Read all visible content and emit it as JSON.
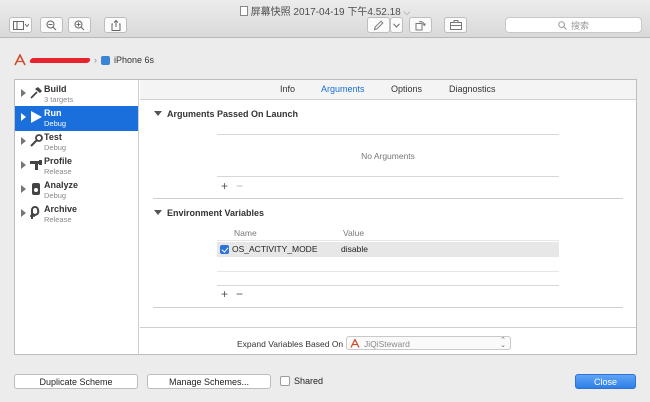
{
  "window": {
    "title": "屏幕快照 2017-04-19 下午4.52.18",
    "search_placeholder": "搜索"
  },
  "scheme": {
    "device": "iPhone 6s"
  },
  "sidebar": {
    "items": [
      {
        "name": "Build",
        "sub": "3 targets",
        "icon": "hammer-icon"
      },
      {
        "name": "Run",
        "sub": "Debug",
        "icon": "play-icon",
        "selected": true
      },
      {
        "name": "Test",
        "sub": "Debug",
        "icon": "wrench-icon"
      },
      {
        "name": "Profile",
        "sub": "Release",
        "icon": "gauge-icon"
      },
      {
        "name": "Analyze",
        "sub": "Debug",
        "icon": "analyze-icon"
      },
      {
        "name": "Archive",
        "sub": "Release",
        "icon": "archive-icon"
      }
    ]
  },
  "tabs": [
    "Info",
    "Arguments",
    "Options",
    "Diagnostics"
  ],
  "active_tab": "Arguments",
  "arguments": {
    "title": "Arguments Passed On Launch",
    "empty_message": "No Arguments",
    "add": "+",
    "remove": "−"
  },
  "environment": {
    "title": "Environment Variables",
    "col_name": "Name",
    "col_value": "Value",
    "rows": [
      {
        "name": "OS_ACTIVITY_MODE",
        "value": "disable",
        "enabled": true
      }
    ],
    "add": "+",
    "remove": "−"
  },
  "expand": {
    "label": "Expand Variables Based On",
    "selected": "JiQiSteward"
  },
  "buttons": {
    "duplicate": "Duplicate Scheme",
    "manage": "Manage Schemes...",
    "shared": "Shared",
    "close": "Close"
  },
  "colors": {
    "accent": "#1a6fdc",
    "redaction": "#e8232e"
  }
}
